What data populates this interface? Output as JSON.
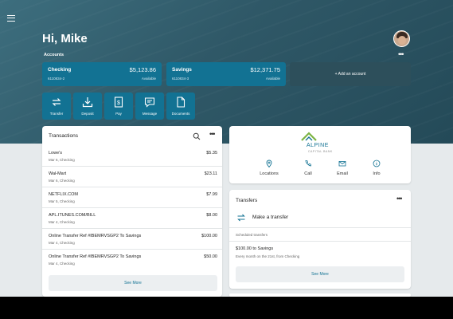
{
  "header": {
    "greeting": "Hi, Mike",
    "accounts_label": "Accounts",
    "more_glyph": "•••"
  },
  "accounts": [
    {
      "name": "Checking",
      "balance": "$5,123.86",
      "number": "6110834-2",
      "status": "Available"
    },
    {
      "name": "Savings",
      "balance": "$12,371.75",
      "number": "6110834-3",
      "status": "Available"
    }
  ],
  "add_account_label": "+ Add an account",
  "quick_actions": [
    {
      "label": "Transfer",
      "icon": "transfer-icon"
    },
    {
      "label": "Deposit",
      "icon": "deposit-icon"
    },
    {
      "label": "Pay",
      "icon": "pay-icon"
    },
    {
      "label": "Message",
      "icon": "message-icon"
    },
    {
      "label": "Documents",
      "icon": "documents-icon"
    }
  ],
  "transactions": {
    "title": "Transactions",
    "more_glyph": "•••",
    "rows": [
      {
        "desc": "Lowe's",
        "sub": "Mar 6, Checking",
        "amount": "$5.35"
      },
      {
        "desc": "Wal-Mart",
        "sub": "Mar 6, Checking",
        "amount": "$23.11"
      },
      {
        "desc": "NETFLIX.COM",
        "sub": "Mar 5, Checking",
        "amount": "$7.99"
      },
      {
        "desc": "APL.ITUNES.COM/BILL",
        "sub": "Mar 4, Checking",
        "amount": "$8.00"
      },
      {
        "desc": "Online Transfer Ref #IBEMRVSGP2 To Savings",
        "sub": "Mar 4, Checking",
        "amount": "$100.00"
      },
      {
        "desc": "Online Transfer Ref #IBEMRVSGP2 To Savings",
        "sub": "Mar 4, Checking",
        "amount": "$50.00"
      }
    ],
    "see_more": "See More"
  },
  "bank": {
    "name": "ALPINE",
    "subtitle": "CAPITAL BANK",
    "brand_color": "#127293",
    "accent_color": "#7cb342",
    "actions": [
      {
        "label": "Locations",
        "icon": "location-pin-icon"
      },
      {
        "label": "Call",
        "icon": "phone-icon"
      },
      {
        "label": "Email",
        "icon": "email-icon"
      },
      {
        "label": "Info",
        "icon": "info-icon"
      }
    ]
  },
  "transfers": {
    "title": "Transfers",
    "more_glyph": "•••",
    "make_label": "Make a transfer",
    "scheduled_label": "Scheduled transfers",
    "scheduled": [
      {
        "amount_line": "$100.00 to Savings",
        "detail": "Every month on the 21st, from Checking"
      }
    ],
    "see_more": "See More"
  }
}
